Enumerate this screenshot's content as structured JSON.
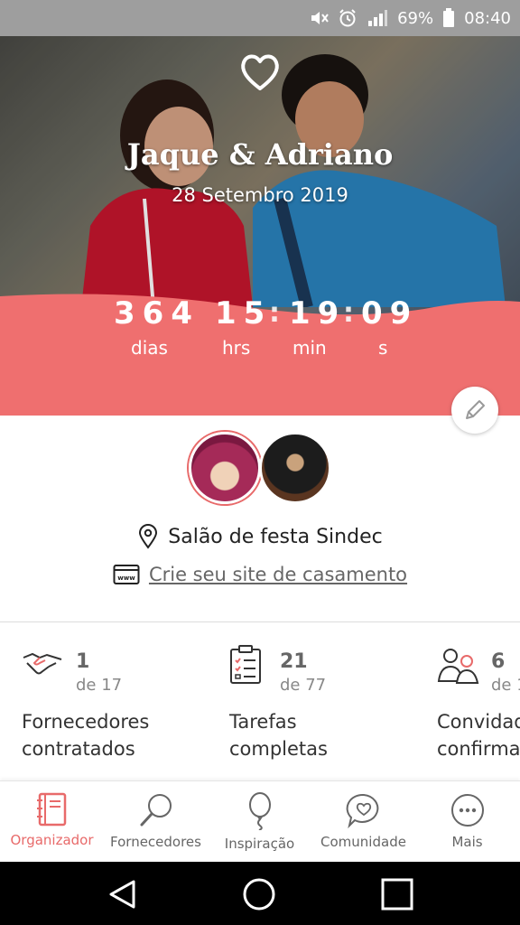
{
  "status_bar": {
    "battery_percent": "69%",
    "time": "08:40"
  },
  "hero": {
    "couple_name": "Jaque & Adriano",
    "wedding_date": "28 Setembro 2019"
  },
  "countdown": {
    "days": "364",
    "days_label": "dias",
    "hours": "15",
    "hours_label": "hrs",
    "minutes": "19",
    "minutes_label": "min",
    "seconds": "09",
    "seconds_label": "s"
  },
  "venue": {
    "name": "Salão de festa Sindec",
    "site_link": "Crie seu site de casamento"
  },
  "stats": [
    {
      "value": "1",
      "of": "de 17",
      "label_line1": "Fornecedores",
      "label_line2": "contratados"
    },
    {
      "value": "21",
      "of": "de 77",
      "label_line1": "Tarefas",
      "label_line2": "completas"
    },
    {
      "value": "6",
      "of": "de 1",
      "label_line1": "Convidad",
      "label_line2": "confirma"
    }
  ],
  "tabs": [
    {
      "label": "Organizador",
      "icon": "notebook-icon",
      "active": true
    },
    {
      "label": "Fornecedores",
      "icon": "magnifier-icon",
      "active": false
    },
    {
      "label": "Inspiração",
      "icon": "balloon-icon",
      "active": false
    },
    {
      "label": "Comunidade",
      "icon": "chat-heart-icon",
      "active": false
    },
    {
      "label": "Mais",
      "icon": "more-dots-icon",
      "active": false
    }
  ],
  "colors": {
    "accent": "#e86a6a",
    "countdown_band": "#ef6f6f"
  }
}
